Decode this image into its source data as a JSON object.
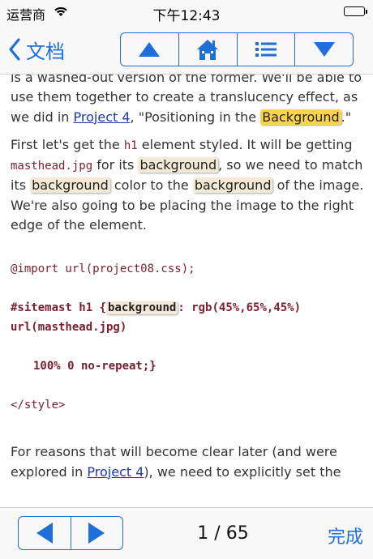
{
  "status_bar": {
    "carrier": "运营商",
    "time": "下午12:43"
  },
  "nav": {
    "back_label": "文档"
  },
  "content": {
    "p1": {
      "t1": "is a washed-out version of the former. We'll be able to use them together to create a translucency effect, as we did in ",
      "link": "Project 4",
      "t2": ", \"Positioning in the ",
      "hl": "Background",
      "t3": ".\""
    },
    "p2": {
      "t1": "First let's get the ",
      "code1": "h1",
      "t2": " element styled. It will be getting ",
      "code2": "masthead.jpg",
      "t3": " for its ",
      "hl1": "background",
      "t4": ", so we need to match its ",
      "hl2": "background",
      "t5": " color to the ",
      "hl3": "background",
      "t6": " of the image. We're also going to be placing the image to the right edge of the element."
    },
    "code": {
      "import": "@import url(project08.css);",
      "sel": "#sitemast h1 {",
      "hl": "background",
      "rest": ": rgb(45%,65%,45%)",
      "line3": "url(masthead.jpg)",
      "line4": "100% 0 no-repeat;}",
      "close": "</style>"
    },
    "p3": {
      "t1": "For reasons that will become clear later (and were explored in ",
      "link": "Project 4",
      "t2": "), we need to explicitly set the"
    }
  },
  "toolbar": {
    "page": "1 / 65",
    "done_label": "完成"
  }
}
